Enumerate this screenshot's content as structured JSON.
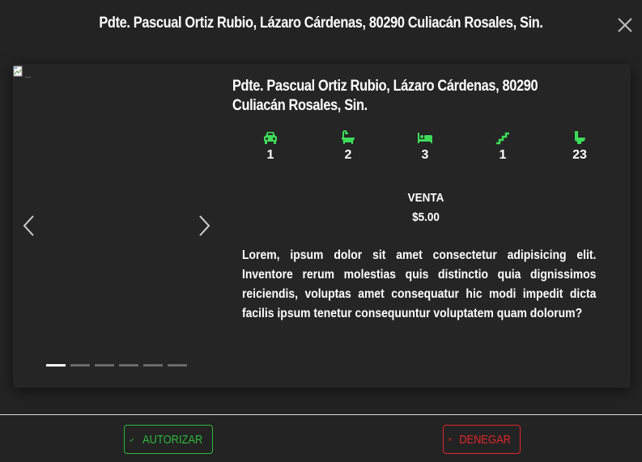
{
  "modal": {
    "title": "Pdte. Pascual Ortiz Rubio, Lázaro Cárdenas, 80290 Culiacán Rosales, Sin."
  },
  "icons": {
    "close": "close-icon",
    "prev": "chevron-left-icon",
    "next": "chevron-right-icon",
    "broken_image": "broken-image-icon",
    "check": "check-icon",
    "x": "x-icon"
  },
  "carousel": {
    "slide_count": 6,
    "active_index": 0
  },
  "property": {
    "title": "Pdte. Pascual Ortiz Rubio, Lázaro Cárdenas, 80290 Culiacán Rosales, Sin.",
    "features": [
      {
        "icon": "car-icon",
        "value": "1"
      },
      {
        "icon": "bathtub-icon",
        "value": "2"
      },
      {
        "icon": "bed-icon",
        "value": "3"
      },
      {
        "icon": "stairs-icon",
        "value": "1"
      },
      {
        "icon": "toilet-icon",
        "value": "23"
      }
    ],
    "sale_type": "VENTA",
    "price": "$5.00",
    "description": "Lorem, ipsum dolor sit amet consectetur adipisicing elit. Inventore rerum molestias quis distinctio quia dignissimos reiciendis, voluptas amet consequatur hic modi impedit dicta facilis ipsum tenetur consequuntur voluptatem quam dolorum?"
  },
  "actions": {
    "authorize_label": "AUTORIZAR",
    "deny_label": "DENEGAR"
  },
  "colors": {
    "background": "#232323",
    "card": "#252525",
    "accent_green": "#2db83d",
    "icon_green": "#3ddc5a",
    "danger_red": "#e0262e"
  }
}
